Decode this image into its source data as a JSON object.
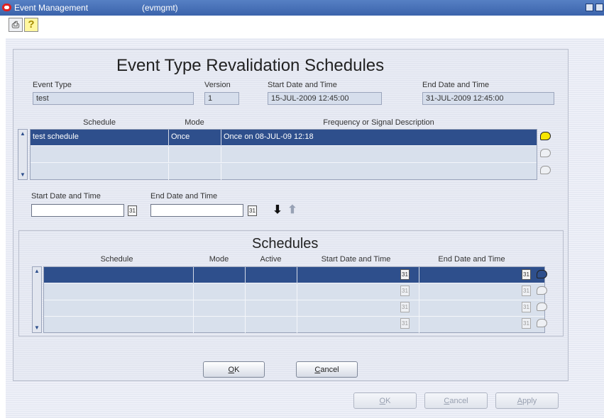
{
  "window": {
    "title": "Event Management",
    "code": "(evmgmt)"
  },
  "dialog": {
    "heading": "Event Type Revalidation Schedules",
    "header_fields": {
      "event_type_label": "Event Type",
      "event_type_value": "test",
      "version_label": "Version",
      "version_value": "1",
      "start_label": "Start Date and Time",
      "start_value": "15-JUL-2009 12:45:00",
      "end_label": "End Date and Time",
      "end_value": "31-JUL-2009 12:45:00"
    },
    "schedule_grid": {
      "columns": [
        "Schedule",
        "Mode",
        "Frequency or Signal Description"
      ],
      "rows": [
        {
          "schedule": "test schedule",
          "mode": "Once",
          "description": "Once on 08-JUL-09 12:18"
        },
        {
          "schedule": "",
          "mode": "",
          "description": ""
        },
        {
          "schedule": "",
          "mode": "",
          "description": ""
        }
      ]
    },
    "range": {
      "start_label": "Start Date and Time",
      "end_label": "End Date and Time",
      "start_value": "",
      "end_value": ""
    },
    "schedules_section": {
      "title": "Schedules",
      "columns": [
        "Schedule",
        "Mode",
        "Active",
        "Start Date and Time",
        "End Date and Time"
      ],
      "rows": [
        {
          "schedule": "",
          "mode": "",
          "active": "",
          "start": "",
          "end": ""
        },
        {
          "schedule": "",
          "mode": "",
          "active": "",
          "start": "",
          "end": ""
        },
        {
          "schedule": "",
          "mode": "",
          "active": "",
          "start": "",
          "end": ""
        },
        {
          "schedule": "",
          "mode": "",
          "active": "",
          "start": "",
          "end": ""
        }
      ]
    },
    "ok_label_a": "O",
    "ok_label_b": "K",
    "cancel_label_a": "C",
    "cancel_label_b": "ancel"
  },
  "footer": {
    "ok_a": "O",
    "ok_b": "K",
    "cancel_a": "C",
    "cancel_b": "ancel",
    "apply_a": "A",
    "apply_b": "pply"
  },
  "icons": {
    "calendar_glyph": "31",
    "arrow_down": "⬇",
    "arrow_up": "⬆",
    "help_glyph": "?",
    "print_glyph": "⎙"
  },
  "colors": {
    "selection": "#2e4f8c",
    "titlebar": "#3b63ab",
    "note_active": "#f7e600"
  }
}
